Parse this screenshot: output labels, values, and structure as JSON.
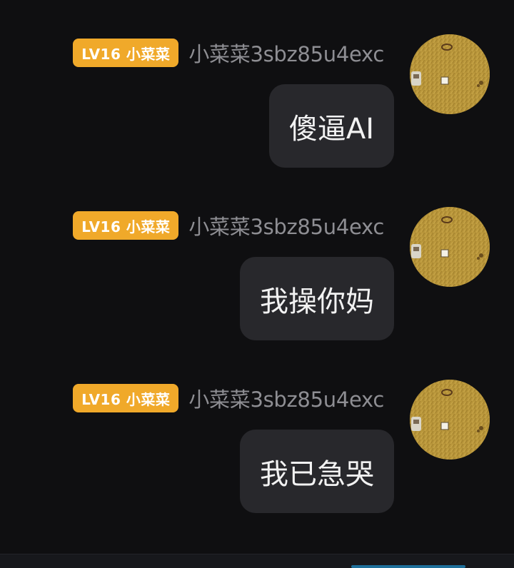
{
  "messages": [
    {
      "badge": "LV16 小菜菜",
      "username": "小菜菜3sbz85u4exc",
      "text": "傻逼AI"
    },
    {
      "badge": "LV16 小菜菜",
      "username": "小菜菜3sbz85u4exc",
      "text": "我操你妈"
    },
    {
      "badge": "LV16 小菜菜",
      "username": "小菜菜3sbz85u4exc",
      "text": "我已急哭"
    }
  ],
  "colors": {
    "background": "#0f0f11",
    "badge": "#f0a92a",
    "username": "#8e8e93",
    "bubble": "#28282c",
    "bubble_text": "#f2f2f2"
  },
  "icons": {
    "avatar": "user-avatar-icon"
  }
}
